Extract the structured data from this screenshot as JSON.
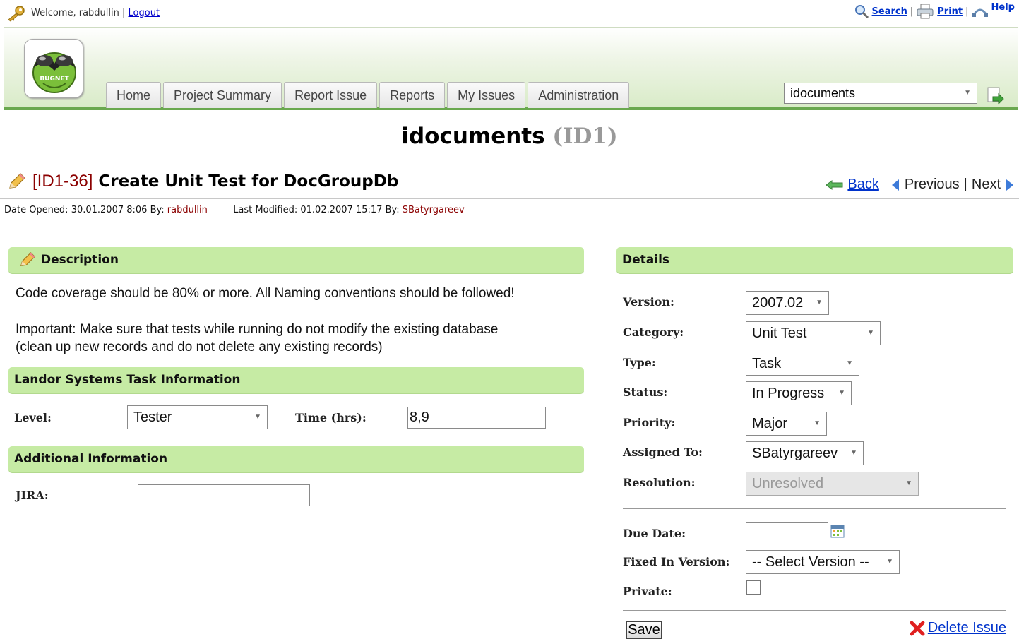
{
  "topbar": {
    "welcome": "Welcome, rabdullin |",
    "logout": "Logout",
    "search": "Search",
    "print": "Print",
    "help": "Help",
    "sep": "|"
  },
  "logo": {
    "text": "BUGNET"
  },
  "tabs": [
    {
      "label": "Home"
    },
    {
      "label": "Project Summary"
    },
    {
      "label": "Report Issue"
    },
    {
      "label": "Reports"
    },
    {
      "label": "My Issues"
    },
    {
      "label": "Administration"
    }
  ],
  "project_select": {
    "value": "idocuments"
  },
  "page": {
    "project_name": "idocuments",
    "project_code": "(ID1)"
  },
  "issue": {
    "id": "[ID1-36]",
    "title": "Create Unit Test for DocGroupDb",
    "back": "Back",
    "previous": "Previous",
    "separator": "|",
    "next": "Next",
    "opened_label": "Date Opened: 30.01.2007 8:06  By:",
    "opened_by": "rabdullin",
    "modified_label": "Last Modified: 01.02.2007 15:17  By:",
    "modified_by": "SBatyrgareev"
  },
  "description": {
    "heading": "Description",
    "line1": "Code coverage should be 80% or more. All Naming conventions should be followed!",
    "line2": "Important: Make sure that tests while running do not modify the existing database",
    "line3": "(clean up new records and do not delete any existing records)"
  },
  "task_info": {
    "heading": "Landor Systems Task Information",
    "level_label": "Level:",
    "level_value": "Tester",
    "time_label": "Time (hrs):",
    "time_value": "8,9"
  },
  "additional": {
    "heading": "Additional Information",
    "jira_label": "JIRA:",
    "jira_value": ""
  },
  "details": {
    "heading": "Details",
    "version_label": "Version:",
    "version_value": "2007.02",
    "category_label": "Category:",
    "category_value": "Unit Test",
    "type_label": "Type:",
    "type_value": "Task",
    "status_label": "Status:",
    "status_value": "In Progress",
    "priority_label": "Priority:",
    "priority_value": "Major",
    "assigned_label": "Assigned To:",
    "assigned_value": "SBatyrgareev",
    "resolution_label": "Resolution:",
    "resolution_value": "Unresolved",
    "due_label": "Due Date:",
    "due_value": "",
    "fixed_label": "Fixed In Version:",
    "fixed_value": "-- Select Version --",
    "private_label": "Private:",
    "private_checked": false
  },
  "actions": {
    "save": "Save",
    "delete": "Delete Issue"
  },
  "colors": {
    "section_bar": "#c6eba4",
    "header_border": "#6aa84f",
    "issue_id": "#8b0000",
    "link": "#0033cc"
  }
}
